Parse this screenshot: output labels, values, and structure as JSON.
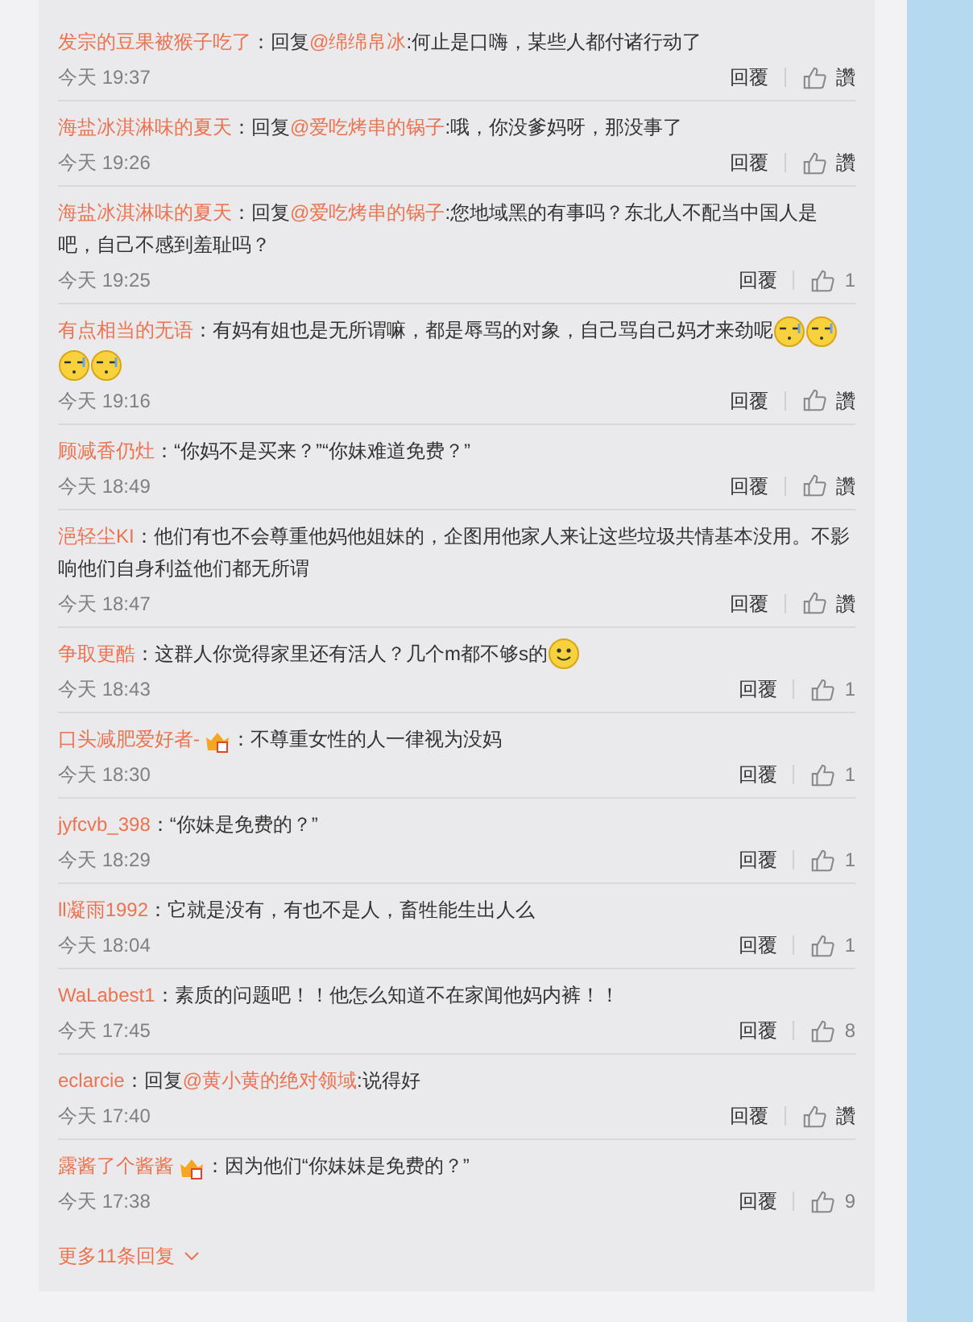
{
  "comments": [
    {
      "user": "发宗的豆果被猴子吃了",
      "parts": [
        {
          "kind": "text",
          "text": "：回复"
        },
        {
          "kind": "mention",
          "text": "@绵绵帛冰"
        },
        {
          "kind": "text",
          "text": ":何止是口嗨，某些人都付诸行动了"
        }
      ],
      "time": "今天 19:37",
      "reply": "回覆",
      "likes": "讚"
    },
    {
      "user": "海盐冰淇淋味的夏天",
      "parts": [
        {
          "kind": "text",
          "text": "：回复"
        },
        {
          "kind": "mention",
          "text": "@爱吃烤串的锅子"
        },
        {
          "kind": "text",
          "text": ":哦，你没爹妈呀，那没事了"
        }
      ],
      "time": "今天 19:26",
      "reply": "回覆",
      "likes": "讚"
    },
    {
      "user": "海盐冰淇淋味的夏天",
      "parts": [
        {
          "kind": "text",
          "text": "：回复"
        },
        {
          "kind": "mention",
          "text": "@爱吃烤串的锅子"
        },
        {
          "kind": "text",
          "text": ":您地域黑的有事吗？东北人不配当中国人是吧，自己不感到羞耻吗？"
        }
      ],
      "time": "今天 19:25",
      "reply": "回覆",
      "likes": "1"
    },
    {
      "user": "有点相当的无语",
      "parts": [
        {
          "kind": "text",
          "text": "：有妈有姐也是无所谓嘛，都是辱骂的对象，自己骂自己妈才来劲呢"
        },
        {
          "kind": "sleepy"
        },
        {
          "kind": "sleepy"
        },
        {
          "kind": "sleepy"
        },
        {
          "kind": "sleepy"
        }
      ],
      "time": "今天 19:16",
      "reply": "回覆",
      "likes": "讚"
    },
    {
      "user": "顾减香仍灶",
      "parts": [
        {
          "kind": "text",
          "text": "：“你妈不是买来？”“你妹难道免费？”"
        }
      ],
      "time": "今天 18:49",
      "reply": "回覆",
      "likes": "讚"
    },
    {
      "user": "浥轻尘KI",
      "parts": [
        {
          "kind": "text",
          "text": "：他们有也不会尊重他妈他姐妹的，企图用他家人来让这些垃圾共情基本没用。不影响他们自身利益他们都无所谓"
        }
      ],
      "time": "今天 18:47",
      "reply": "回覆",
      "likes": "讚"
    },
    {
      "user": "争取更酷",
      "parts": [
        {
          "kind": "text",
          "text": "：这群人你觉得家里还有活人？几个m都不够s的"
        },
        {
          "kind": "smile"
        }
      ],
      "time": "今天 18:43",
      "reply": "回覆",
      "likes": "1"
    },
    {
      "user": "口头减肥爱好者-",
      "badge": true,
      "parts": [
        {
          "kind": "text",
          "text": "：不尊重女性的人一律视为没妈"
        }
      ],
      "time": "今天 18:30",
      "reply": "回覆",
      "likes": "1"
    },
    {
      "user": "jyfcvb_398",
      "parts": [
        {
          "kind": "text",
          "text": "：“你妹是免费的？”"
        }
      ],
      "time": "今天 18:29",
      "reply": "回覆",
      "likes": "1"
    },
    {
      "user": "ll凝雨1992",
      "parts": [
        {
          "kind": "text",
          "text": "：它就是没有，有也不是人，畜牲能生出人么"
        }
      ],
      "time": "今天 18:04",
      "reply": "回覆",
      "likes": "1"
    },
    {
      "user": "WaLabest1",
      "parts": [
        {
          "kind": "text",
          "text": "：素质的问题吧！！他怎么知道不在家闻他妈内裤！！"
        }
      ],
      "time": "今天 17:45",
      "reply": "回覆",
      "likes": "8"
    },
    {
      "user": "eclarcie",
      "parts": [
        {
          "kind": "text",
          "text": "：回复"
        },
        {
          "kind": "mention",
          "text": "@黄小黄的绝对领域"
        },
        {
          "kind": "text",
          "text": ":说得好"
        }
      ],
      "time": "今天 17:40",
      "reply": "回覆",
      "likes": "讚"
    },
    {
      "user": "露酱了个酱酱",
      "badge": true,
      "parts": [
        {
          "kind": "text",
          "text": "：因为他们“你妹妹是免费的？”"
        }
      ],
      "time": "今天 17:38",
      "reply": "回覆",
      "likes": "9"
    }
  ],
  "more": "更多11条回复"
}
